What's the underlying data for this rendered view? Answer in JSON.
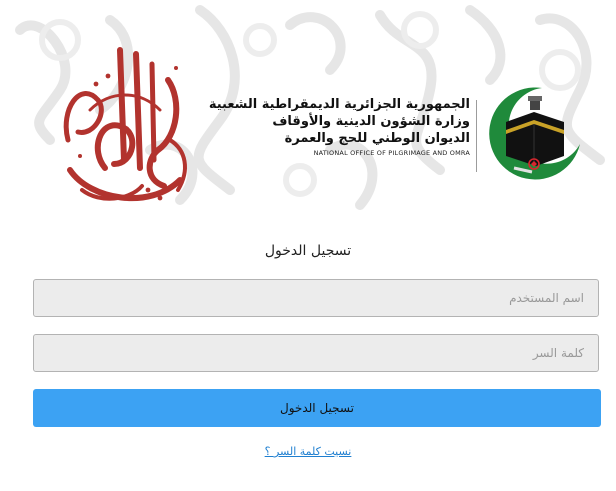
{
  "header": {
    "org_lines": [
      "الجمهورية الجزائرية الديمقراطية الشعبية",
      "وزارة الشؤون الدينية والأوقاف",
      "الديوان الوطني للحج والعمرة"
    ],
    "org_english": "NATIONAL OFFICE OF PILGRIMAGE AND OMRA",
    "calligraphy_logo": "arabic-calligraphy-logo",
    "emblem": "kaaba-crescent-emblem",
    "colors": {
      "calligraphy": "#b2332e",
      "emblem_green": "#1f8a3b",
      "kaaba": "#111111",
      "gold": "#c9a227"
    }
  },
  "login": {
    "title": "تسجيل الدخول",
    "username_placeholder": "اسم المستخدم",
    "password_placeholder": "كلمة السر",
    "submit_label": "تسجيل الدخول",
    "forgot_password": "نسيت كلمة السر ؟"
  },
  "colors": {
    "button": "#3ca2f3",
    "link": "#1f7fd0",
    "field_bg": "#ececec"
  }
}
